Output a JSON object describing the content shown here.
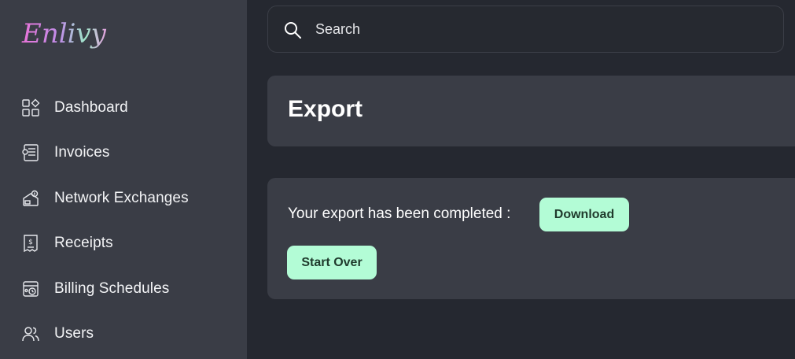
{
  "brand": {
    "logo_text": "Enlivy"
  },
  "sidebar": {
    "items": [
      {
        "label": "Dashboard",
        "icon": "dashboard-icon"
      },
      {
        "label": "Invoices",
        "icon": "invoice-icon"
      },
      {
        "label": "Network Exchanges",
        "icon": "network-exchange-icon"
      },
      {
        "label": "Receipts",
        "icon": "receipt-icon"
      },
      {
        "label": "Billing Schedules",
        "icon": "billing-schedule-icon"
      },
      {
        "label": "Users",
        "icon": "users-icon"
      }
    ]
  },
  "search": {
    "placeholder": "Search",
    "value": ""
  },
  "page": {
    "title": "Export"
  },
  "export": {
    "message": "Your export has been completed :",
    "download_label": "Download",
    "start_over_label": "Start Over"
  },
  "colors": {
    "sidebar_bg": "#3a3d46",
    "page_bg": "#252830",
    "card_bg": "#3a3d46",
    "button_bg": "#b3fcd6",
    "button_text": "#1f3a2c"
  }
}
